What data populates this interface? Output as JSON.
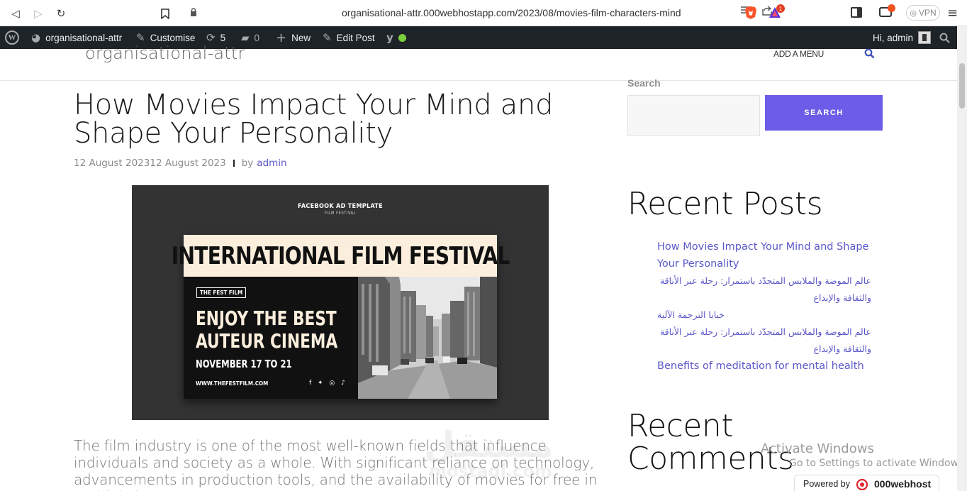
{
  "browser": {
    "url": "organisational-attr.000webhostapp.com/2023/08/movies-film-characters-mind",
    "vpn_label": "VPN",
    "rewards_count": "1"
  },
  "admin_bar": {
    "site_name": "organisational-attr",
    "customise": "Customise",
    "updates_count": "5",
    "comments_count": "0",
    "new_label": "New",
    "edit_post": "Edit Post",
    "greeting": "Hi, admin"
  },
  "header": {
    "site_title": "organisational-attr",
    "menu_link": "ADD A MENU"
  },
  "post": {
    "title": "How Movies Impact Your Mind and Shape Your Personality",
    "date": "12 August 202312 August 2023",
    "by": "by",
    "author": "admin",
    "excerpt": "The film industry is one of the most well-known fields that influence individuals and society as a whole. With significant reliance on technology, advancements in production tools, and the availability of movies for free in multiple languages."
  },
  "featured_image": {
    "top_line": "FACEBOOK AD TEMPLATE",
    "sub_line": "FILM FESTIVAL",
    "banner": "INTERNATIONAL FILM FESTIVAL",
    "badge": "THE FEST FILM",
    "headline_1": "ENJOY THE BEST",
    "headline_2": "AUTEUR CINEMA",
    "dates": "NOVEMBER 17 TO 21",
    "url": "WWW.THEFESTFILM.COM"
  },
  "sidebar": {
    "search_label": "Search",
    "search_button": "SEARCH",
    "recent_posts_title": "Recent Posts",
    "recent_posts": [
      "How Movies Impact Your Mind and Shape Your Personality",
      "عالم الموضة والملابس المتجدّد باستمرار: رحلة عبر الأناقة والثقافة والإبداع",
      "خبايا الترجمة الآلية",
      "عالم الموضة والملابس المتجدّد باستمرار: رحلة عبر الأناقة والثقافة والإبداع",
      "Benefits of meditation for mental health"
    ],
    "recent_comments_title": "Recent Comments"
  },
  "overlays": {
    "activate_1": "Activate Windows",
    "activate_2": "Go to Settings to activate Windows.",
    "powered_by": "Powered by",
    "powered_brand": "000webhost",
    "watermark": "مستقل",
    "watermark_sub": "mostaql.com"
  },
  "colors": {
    "accent": "#6c5ce7",
    "link": "#5a58c8",
    "admin_bar": "#1d2327"
  }
}
